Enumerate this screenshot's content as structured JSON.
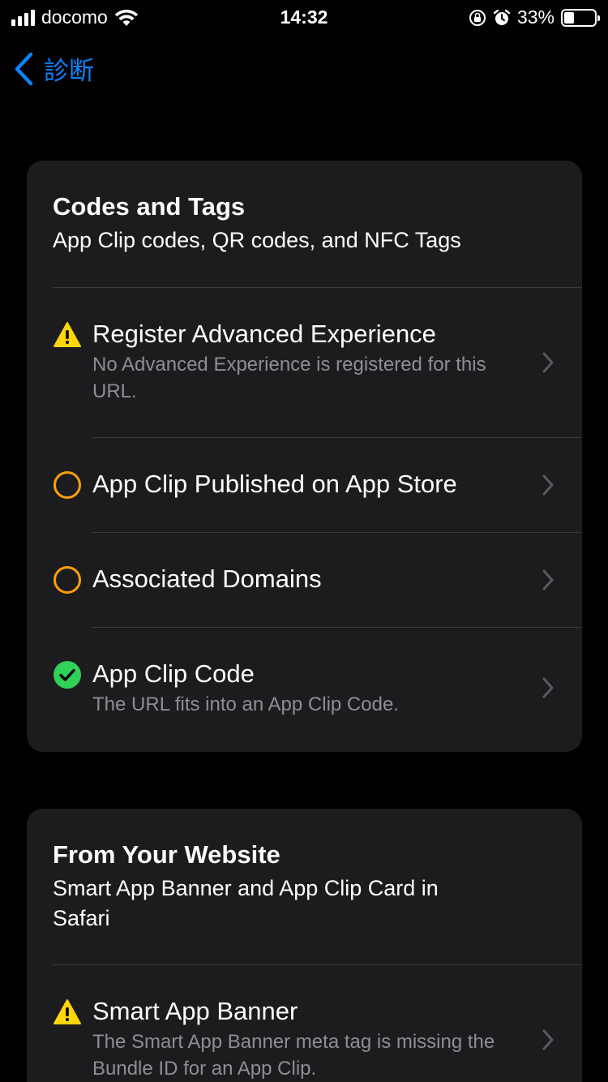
{
  "status_bar": {
    "carrier": "docomo",
    "time": "14:32",
    "battery_percent": "33%",
    "battery_level": 0.33
  },
  "nav": {
    "back_label": "診断"
  },
  "sections": [
    {
      "title": "Codes and Tags",
      "subtitle": "App Clip codes, QR codes, and NFC Tags",
      "items": [
        {
          "status": "warning",
          "icon": "warning-triangle-icon",
          "title": "Register Advanced Experience",
          "description": "No Advanced Experience is registered for this URL."
        },
        {
          "status": "pending",
          "icon": "empty-circle-icon",
          "title": "App Clip Published on App Store",
          "description": ""
        },
        {
          "status": "pending",
          "icon": "empty-circle-icon",
          "title": "Associated Domains",
          "description": ""
        },
        {
          "status": "success",
          "icon": "checkmark-circle-icon",
          "title": "App Clip Code",
          "description": "The URL fits into an App Clip Code."
        }
      ]
    },
    {
      "title": "From Your Website",
      "subtitle": "Smart App Banner and App Clip Card in Safari",
      "items": [
        {
          "status": "warning",
          "icon": "warning-triangle-icon",
          "title": "Smart App Banner",
          "description": "The Smart App Banner meta tag is missing the Bundle ID for an App Clip."
        }
      ]
    }
  ],
  "colors": {
    "accent": "#0a84ff",
    "warning": "#ffd60a",
    "pending": "#ff9f0a",
    "success": "#30d158",
    "card": "#1c1c1e"
  }
}
